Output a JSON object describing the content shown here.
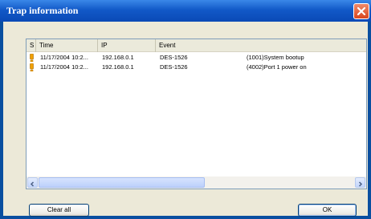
{
  "window": {
    "title": "Trap information",
    "close_icon": "close-icon"
  },
  "table": {
    "columns": [
      "S",
      "Time",
      "IP",
      "Event"
    ],
    "rows": [
      {
        "severity_icon": "warning-icon",
        "time": "11/17/2004 10:2...",
        "ip": "192.168.0.1",
        "device": "DES-1526",
        "event": "(1001)System bootup"
      },
      {
        "severity_icon": "warning-icon",
        "time": "11/17/2004 10:2...",
        "ip": "192.168.0.1",
        "device": "DES-1526",
        "event": "(4002)Port 1 power on"
      }
    ]
  },
  "buttons": {
    "clear_all": "Clear all",
    "ok": "OK"
  },
  "colors": {
    "titlebar": "#1259c8",
    "frame": "#0a4fa0",
    "warning": "#f0a000"
  }
}
